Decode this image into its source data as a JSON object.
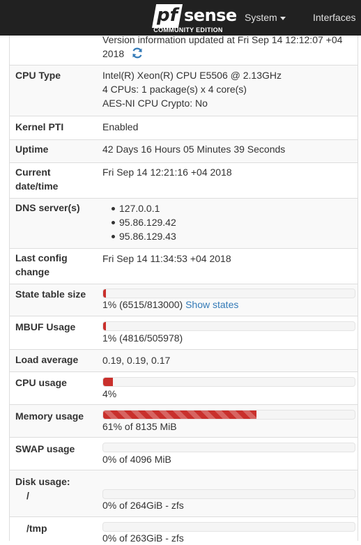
{
  "navbar": {
    "logo_mark": "pf",
    "logo_word": "sense",
    "logo_sub": "COMMUNITY EDITION",
    "system_label": "System",
    "interfaces_label": "Interfaces"
  },
  "version": {
    "line1": "Version information updated at Fri Sep 14 12:12:07 +04",
    "line2": "2018"
  },
  "rows": {
    "cpu_type": {
      "label": "CPU Type",
      "line1": "Intel(R) Xeon(R) CPU E5506 @ 2.13GHz",
      "line2": "4 CPUs: 1 package(s) x 4 core(s)",
      "line3": "AES-NI CPU Crypto: No"
    },
    "kernel_pti": {
      "label": "Kernel PTI",
      "value": "Enabled"
    },
    "uptime": {
      "label": "Uptime",
      "value": "42 Days 16 Hours 05 Minutes 39 Seconds"
    },
    "current_datetime": {
      "label_line1": "Current",
      "label_line2": "date/time",
      "value": "Fri Sep 14 12:21:16 +04 2018"
    },
    "dns_servers": {
      "label": "DNS server(s)",
      "servers": [
        "127.0.0.1",
        "95.86.129.42",
        "95.86.129.43"
      ]
    },
    "last_config": {
      "label_line1": "Last config",
      "label_line2": "change",
      "value": "Fri Sep 14 11:34:53 +04 2018"
    },
    "state_table": {
      "label": "State table size",
      "text": "1% (6515/813000)",
      "link": "Show states",
      "percent": 1
    },
    "mbuf": {
      "label": "MBUF Usage",
      "text": "1% (4816/505978)",
      "percent": 1
    },
    "load_avg": {
      "label": "Load average",
      "value": "0.19, 0.19, 0.17"
    },
    "cpu_usage": {
      "label": "CPU usage",
      "text": "4%",
      "percent": 4
    },
    "memory": {
      "label": "Memory usage",
      "text": "61% of 8135 MiB",
      "percent": 61
    },
    "swap": {
      "label": "SWAP usage",
      "text": "0% of 4096 MiB",
      "percent": 0
    },
    "disk": {
      "label": "Disk usage:",
      "root_label": "/",
      "root_text": "0% of 264GiB - zfs",
      "root_percent": 0,
      "tmp_label": "/tmp",
      "tmp_text": "0% of 263GiB - zfs",
      "tmp_percent": 0
    }
  },
  "colors": {
    "bar_fill": "#c9302c",
    "link": "#337ab7",
    "navbar": "#212121"
  }
}
